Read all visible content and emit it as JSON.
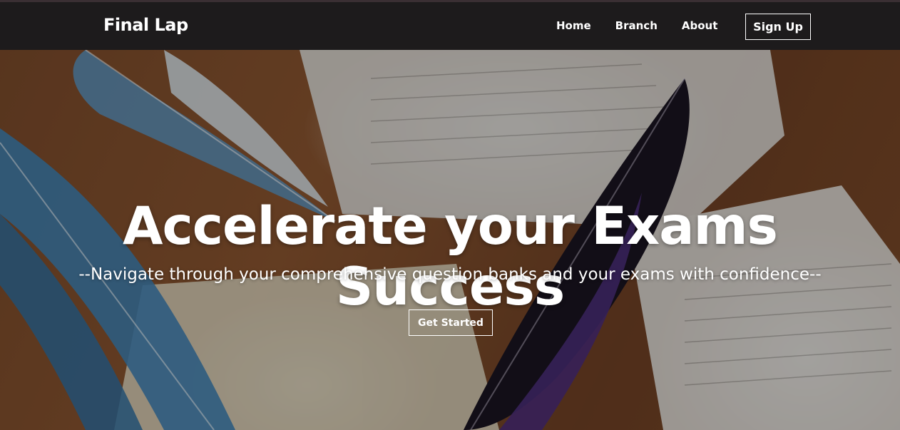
{
  "header": {
    "brand": "Final Lap",
    "nav": [
      {
        "label": "Home"
      },
      {
        "label": "Branch"
      },
      {
        "label": "About"
      }
    ],
    "signup_label": "Sign Up"
  },
  "hero": {
    "title": "Accelerate your Exams Success",
    "subtitle": "--Navigate through your comprehensive question banks and your exams with confidence--",
    "cta_label": "Get Started",
    "background_image": "feathers-and-exam-papers-on-wooden-desk"
  },
  "colors": {
    "navbar_bg": "#1d1b1c",
    "text": "#ffffff",
    "wood": "#7a4a2a"
  }
}
